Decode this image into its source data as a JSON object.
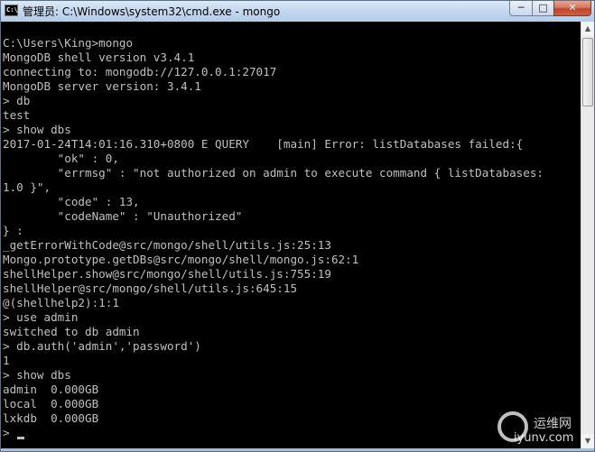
{
  "window": {
    "title": "管理员: C:\\Windows\\system32\\cmd.exe - mongo",
    "icon_label": "C:\\",
    "buttons": {
      "minimize": "─",
      "maximize": "□",
      "close": "✕"
    }
  },
  "console": {
    "lines": [
      "",
      "C:\\Users\\King>mongo",
      "MongoDB shell version v3.4.1",
      "connecting to: mongodb://127.0.0.1:27017",
      "MongoDB server version: 3.4.1",
      "> db",
      "test",
      "> show dbs",
      "2017-01-24T14:01:16.310+0800 E QUERY    [main] Error: listDatabases failed:{",
      "        \"ok\" : 0,",
      "        \"errmsg\" : \"not authorized on admin to execute command { listDatabases:",
      "1.0 }\",",
      "        \"code\" : 13,",
      "        \"codeName\" : \"Unauthorized\"",
      "} :",
      "_getErrorWithCode@src/mongo/shell/utils.js:25:13",
      "Mongo.prototype.getDBs@src/mongo/shell/mongo.js:62:1",
      "shellHelper.show@src/mongo/shell/utils.js:755:19",
      "shellHelper@src/mongo/shell/utils.js:645:15",
      "@(shellhelp2):1:1",
      "> use admin",
      "switched to db admin",
      "> db.auth('admin','password')",
      "1",
      "> show dbs",
      "admin  0.000GB",
      "local  0.000GB",
      "lxkdb  0.000GB",
      "> "
    ]
  },
  "watermark": {
    "brand": "运维网",
    "url": "iyunv.com"
  }
}
